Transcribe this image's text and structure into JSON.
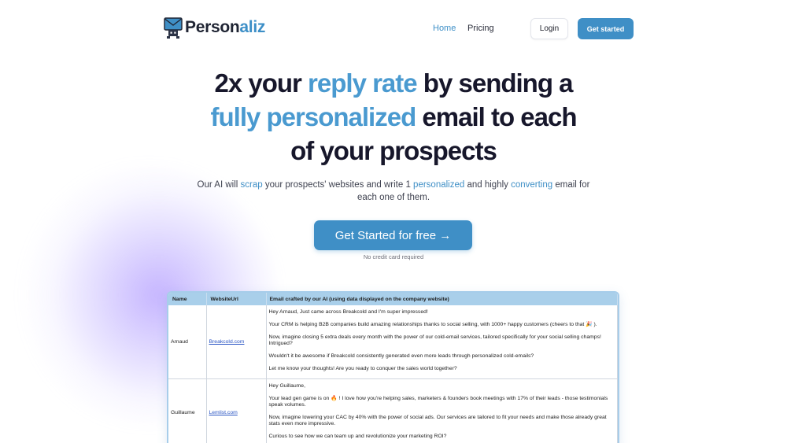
{
  "nav": {
    "brand_main": "Person",
    "brand_accent": "aliz",
    "home": "Home",
    "pricing": "Pricing",
    "login": "Login",
    "get_started": "Get started"
  },
  "hero": {
    "line1_a": "2x your ",
    "line1_b": "reply rate",
    "line1_c": " by sending a",
    "line2_a": "fully personalized",
    "line2_b": " email to each",
    "line3": "of your prospects",
    "sub_a": "Our AI will ",
    "sub_b": "scrap",
    "sub_c": " your prospects' websites and write 1 ",
    "sub_d": "personalized",
    "sub_e": " and highly ",
    "sub_f": "converting",
    "sub_g": " email for each one of them.",
    "cta": "Get Started for free →",
    "no_card": "No credit card required"
  },
  "table": {
    "headers": [
      "Name",
      "WebsiteUrl",
      "Email crafted by our AI (using data displayed on the company website)"
    ],
    "rows": [
      {
        "name": "Arnaud",
        "url": "Breakcold.com",
        "email": [
          "Hey Arnaud, Just came across Breakcold and I'm super impressed!",
          "Your CRM is helping B2B companies build amazing relationships thanks to social selling, with 1000+ happy customers (cheers to that 🎉 ).",
          "Now, imagine closing 5 extra deals every month with the power of our cold-email services, tailored specifically for your social selling champs! Intrigued?",
          "Wouldn't it be awesome if Breakcold consistently generated even more leads through personalized cold-emails?",
          "Let me know your thoughts! Are you ready to conquer the sales world together?"
        ]
      },
      {
        "name": "Guillaume",
        "url": "Lemlist.com",
        "email": [
          "Hey Guillaume,",
          "Your lead gen game is on 🔥 ! I love how you're helping sales, marketers & founders book meetings with 17% of their leads - those testimonials speak volumes.",
          "Now, imagine lowering your CAC by 40% with the power of social ads. Our services are tailored to fit your needs and make those already great stats even more impressive.",
          "Curious to see how we can team up and revolutionize your marketing ROI?"
        ]
      }
    ]
  },
  "colors": {
    "accent": "#3f8fc6",
    "table_header": "#a9cfea",
    "glow": "#9b7bff"
  },
  "icons": {
    "logo": "envelope-robot-icon"
  }
}
